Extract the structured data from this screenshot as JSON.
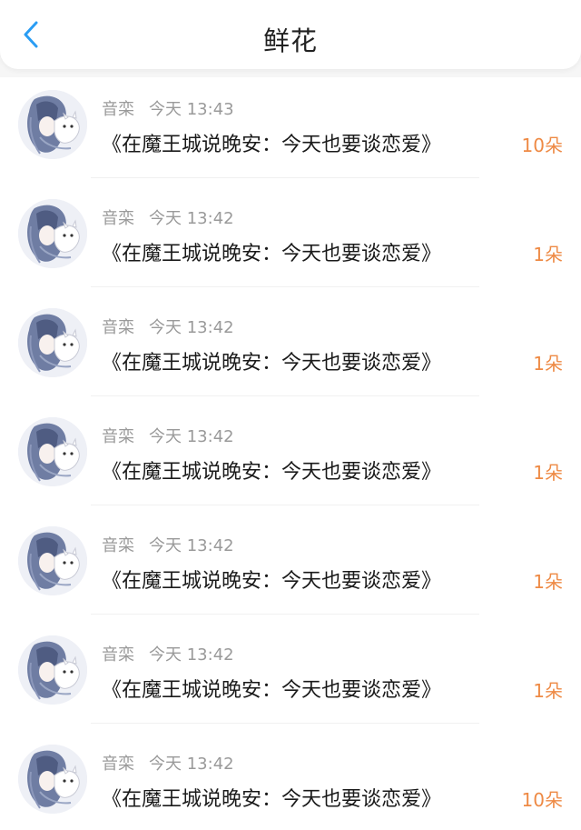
{
  "header": {
    "title": "鲜花"
  },
  "colors": {
    "back_icon": "#2a9df4",
    "count": "#ee8a45",
    "meta": "#9a9a9a"
  },
  "icons": {
    "back": "chevron-left-icon",
    "avatar": "anime-girl-avatar"
  },
  "records": [
    {
      "user": "音栾",
      "time": "今天 13:43",
      "book": "《在魔王城说晚安：今天也要谈恋爱》",
      "count": "10朵"
    },
    {
      "user": "音栾",
      "time": "今天 13:42",
      "book": "《在魔王城说晚安：今天也要谈恋爱》",
      "count": "1朵"
    },
    {
      "user": "音栾",
      "time": "今天 13:42",
      "book": "《在魔王城说晚安：今天也要谈恋爱》",
      "count": "1朵"
    },
    {
      "user": "音栾",
      "time": "今天 13:42",
      "book": "《在魔王城说晚安：今天也要谈恋爱》",
      "count": "1朵"
    },
    {
      "user": "音栾",
      "time": "今天 13:42",
      "book": "《在魔王城说晚安：今天也要谈恋爱》",
      "count": "1朵"
    },
    {
      "user": "音栾",
      "time": "今天 13:42",
      "book": "《在魔王城说晚安：今天也要谈恋爱》",
      "count": "1朵"
    },
    {
      "user": "音栾",
      "time": "今天 13:42",
      "book": "《在魔王城说晚安：今天也要谈恋爱》",
      "count": "10朵"
    }
  ]
}
